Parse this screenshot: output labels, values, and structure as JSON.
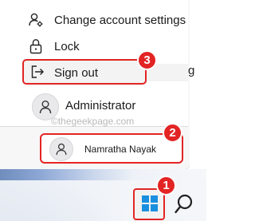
{
  "menu": {
    "change_account_settings": "Change account settings",
    "lock": "Lock",
    "sign_out": "Sign out"
  },
  "current_user": {
    "name": "Administrator"
  },
  "other_user": {
    "name": "Namratha Nayak"
  },
  "watermark": "©thegeekpage.com",
  "obscured_text_fragment": "g",
  "annotations": {
    "badge_1": "1",
    "badge_2": "2",
    "badge_3": "3"
  },
  "colors": {
    "annotation_red": "#e32424",
    "windows_blue": "#1a8fe0"
  },
  "icons": {
    "change_account_settings": "people-settings-icon",
    "lock": "lock-icon",
    "sign_out": "sign-out-icon",
    "avatar": "user-avatar-icon",
    "start": "windows-logo-icon",
    "search": "search-icon"
  }
}
